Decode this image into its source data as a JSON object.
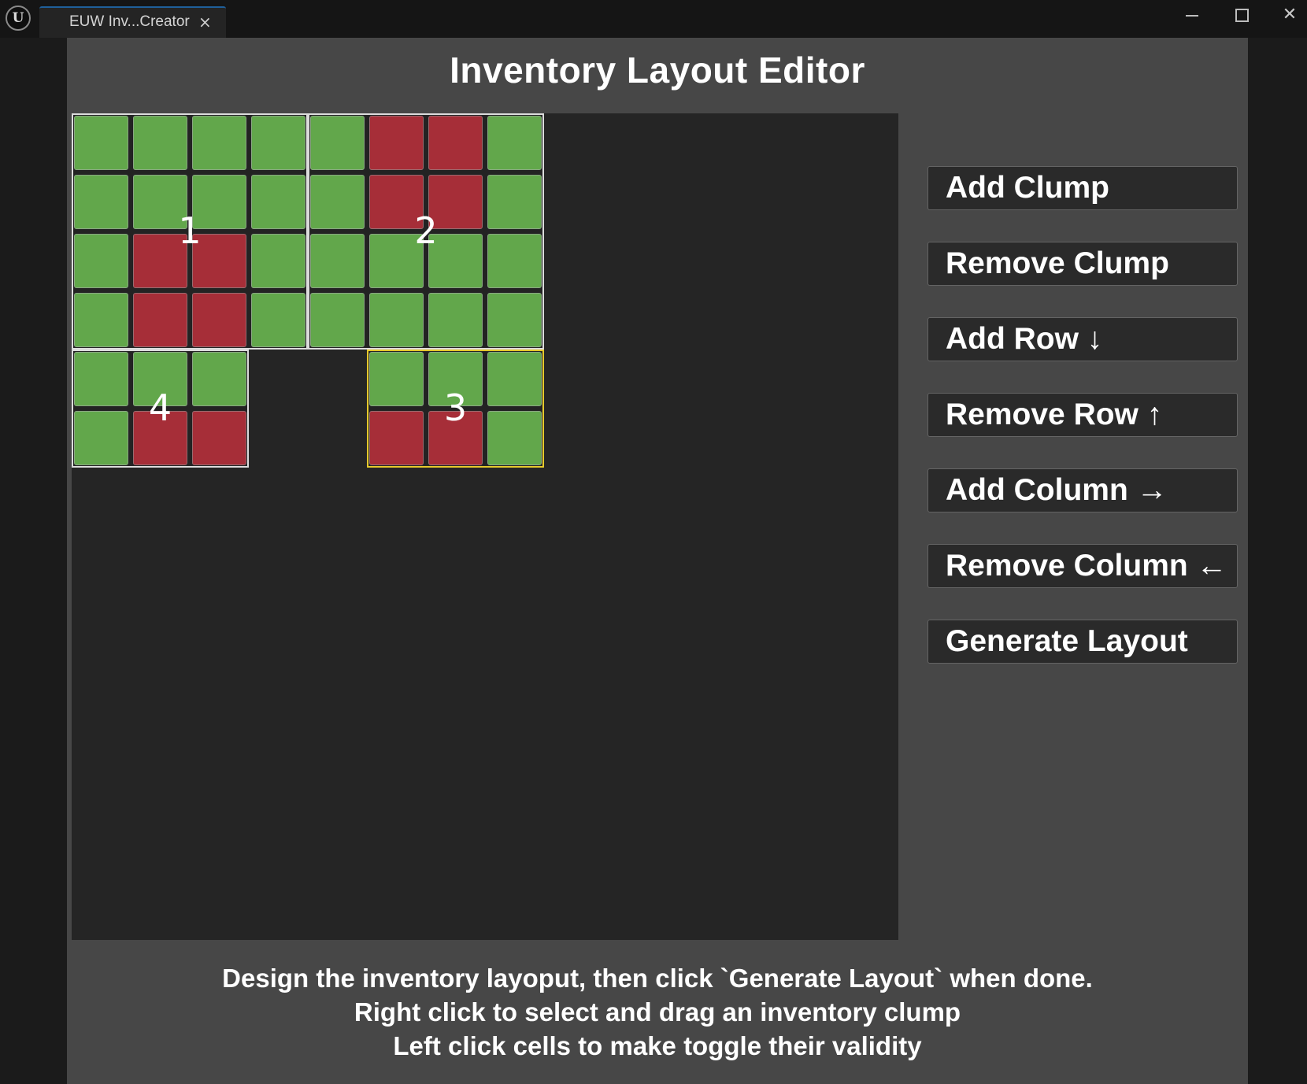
{
  "window": {
    "tab_label": "EUW Inv...Creator",
    "tab_close_glyph": "×",
    "logo_glyph": "U",
    "close_glyph": "✕"
  },
  "editor": {
    "title": "Inventory Layout Editor",
    "clumps": [
      {
        "label": "1",
        "columns": 4,
        "rows": 4,
        "selected": false,
        "cells": [
          [
            1,
            1,
            1,
            1
          ],
          [
            1,
            1,
            1,
            1
          ],
          [
            1,
            0,
            0,
            1
          ],
          [
            1,
            0,
            0,
            1
          ]
        ]
      },
      {
        "label": "2",
        "columns": 4,
        "rows": 4,
        "selected": false,
        "cells": [
          [
            1,
            0,
            0,
            1
          ],
          [
            1,
            0,
            0,
            1
          ],
          [
            1,
            1,
            1,
            1
          ],
          [
            1,
            1,
            1,
            1
          ]
        ]
      },
      {
        "label": "3",
        "columns": 3,
        "rows": 2,
        "selected": true,
        "cells": [
          [
            1,
            1,
            1
          ],
          [
            0,
            0,
            1
          ]
        ]
      },
      {
        "label": "4",
        "columns": 3,
        "rows": 2,
        "selected": false,
        "cells": [
          [
            1,
            1,
            1
          ],
          [
            1,
            0,
            0
          ]
        ]
      }
    ],
    "colors": {
      "valid_cell": "#62a74b",
      "invalid_cell": "#a62e38",
      "selected_border": "#e6c92c",
      "clump_border": "#dcdcdc"
    }
  },
  "buttons": {
    "add_clump": "Add Clump",
    "remove_clump": "Remove Clump",
    "add_row": "Add Row ↓",
    "remove_row": "Remove Row ↑",
    "add_column": "Add Column →",
    "remove_column": "Remove Column ←",
    "generate_layout": "Generate Layout"
  },
  "instructions": {
    "line1": "Design the inventory layoput, then click `Generate Layout` when done.",
    "line2": "Right click to select and drag an inventory clump",
    "line3": "Left click cells to make toggle their validity"
  }
}
